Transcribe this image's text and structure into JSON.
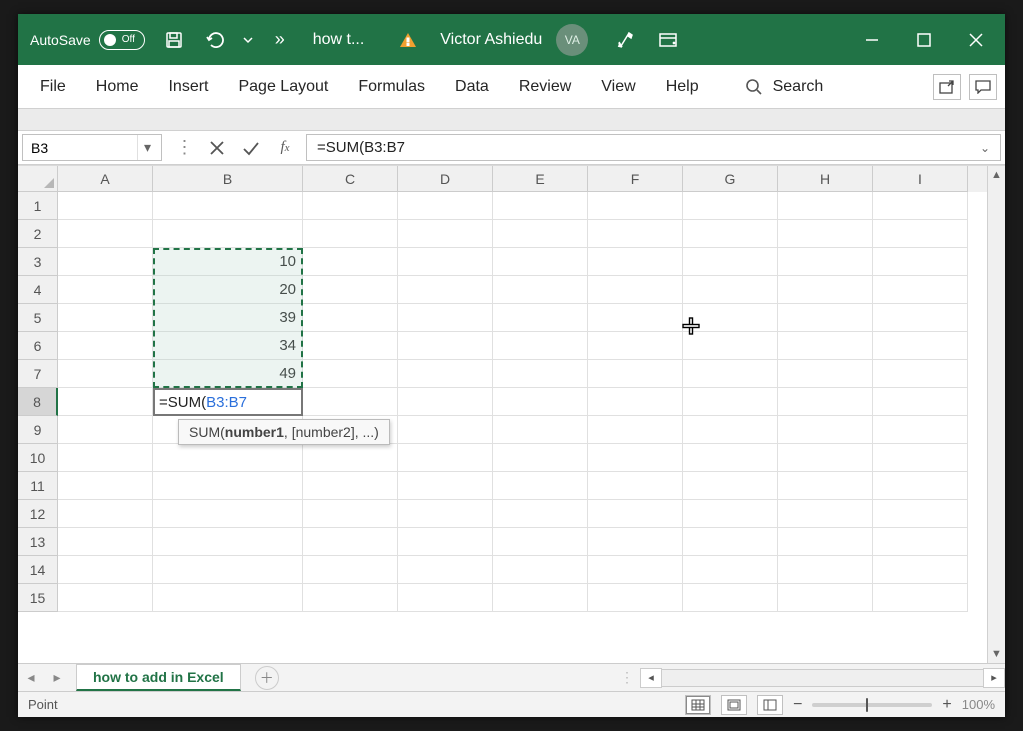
{
  "titlebar": {
    "autosave_label": "AutoSave",
    "autosave_state": "Off",
    "doc_title": "how t...",
    "user_name": "Victor Ashiedu",
    "user_initials": "VA"
  },
  "ribbon": {
    "tabs": [
      "File",
      "Home",
      "Insert",
      "Page Layout",
      "Formulas",
      "Data",
      "Review",
      "View",
      "Help"
    ],
    "search_label": "Search"
  },
  "formula_bar": {
    "name_box": "B3",
    "formula": "=SUM(B3:B7",
    "formula_prefix": "=SUM(",
    "formula_ref": "B3:B7"
  },
  "grid": {
    "columns": [
      "A",
      "B",
      "C",
      "D",
      "E",
      "F",
      "G",
      "H",
      "I"
    ],
    "rows": 15,
    "data": {
      "B3": "10",
      "B4": "20",
      "B5": "39",
      "B6": "34",
      "B7": "49"
    },
    "edit_cell": {
      "row": 8,
      "col": "B",
      "prefix": "=SUM(",
      "ref": "B3:B7"
    },
    "selection": {
      "col": "B",
      "row_start": 3,
      "row_end": 7
    },
    "tooltip": {
      "fn": "SUM",
      "sig_bold": "number1",
      "sig_rest": ", [number2], ...)"
    }
  },
  "sheettabs": {
    "active": "how to add in Excel"
  },
  "status": {
    "mode": "Point",
    "zoom": "100%"
  }
}
